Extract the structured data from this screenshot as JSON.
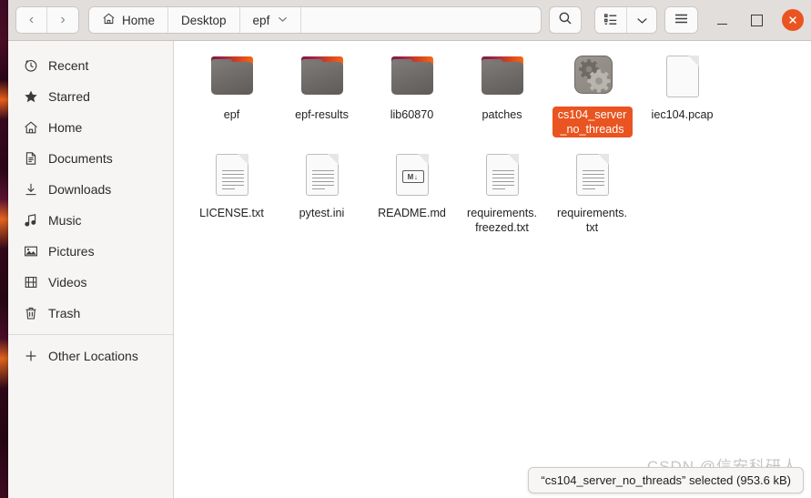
{
  "window": {
    "titlebar": {
      "nav_back": "‹",
      "nav_forward": "›",
      "breadcrumbs": [
        {
          "label": "Home",
          "icon": "home-icon",
          "has_chevron": false
        },
        {
          "label": "Desktop",
          "icon": null,
          "has_chevron": false
        },
        {
          "label": "epf",
          "icon": null,
          "has_chevron": true
        }
      ],
      "search_icon": "search-icon",
      "view_list_icon": "list-view-icon",
      "view_dropdown_icon": "chevron-down-icon",
      "menu_icon": "hamburger-menu-icon",
      "minimize_label": "Minimize",
      "maximize_label": "Maximize",
      "close_label": "Close",
      "close_color": "#e95420"
    }
  },
  "sidebar": {
    "items": [
      {
        "label": "Recent",
        "icon": "clock-icon"
      },
      {
        "label": "Starred",
        "icon": "star-icon"
      },
      {
        "label": "Home",
        "icon": "home-icon"
      },
      {
        "label": "Documents",
        "icon": "document-icon"
      },
      {
        "label": "Downloads",
        "icon": "download-icon"
      },
      {
        "label": "Music",
        "icon": "music-note-icon"
      },
      {
        "label": "Pictures",
        "icon": "picture-icon"
      },
      {
        "label": "Videos",
        "icon": "film-icon"
      },
      {
        "label": "Trash",
        "icon": "trash-icon"
      }
    ],
    "other_locations": {
      "label": "Other Locations",
      "icon": "plus-icon"
    }
  },
  "files": [
    {
      "name": "epf",
      "type": "folder",
      "selected": false
    },
    {
      "name": "epf-results",
      "type": "folder",
      "selected": false
    },
    {
      "name": "lib60870",
      "type": "folder",
      "selected": false
    },
    {
      "name": "patches",
      "type": "folder",
      "selected": false
    },
    {
      "name": "cs104_server_no_threads",
      "type": "executable",
      "selected": true
    },
    {
      "name": "iec104.pcap",
      "type": "blank-document",
      "selected": false
    },
    {
      "name": "LICENSE.txt",
      "type": "text-document",
      "selected": false
    },
    {
      "name": "pytest.ini",
      "type": "text-document",
      "selected": false
    },
    {
      "name": "README.md",
      "type": "markdown-document",
      "selected": false
    },
    {
      "name": "requirements.freezed.txt",
      "type": "text-document",
      "selected": false
    },
    {
      "name": "requirements.txt",
      "type": "text-document",
      "selected": false
    }
  ],
  "markdown_badge_text": "M↓",
  "statusbar": {
    "text": "“cs104_server_no_threads” selected (953.6 kB)"
  },
  "watermark": {
    "text": "CSDN @信安科研人"
  },
  "colors": {
    "selection": "#e95420",
    "headerbar": "#e1dedb",
    "sidebar": "#f6f5f4"
  }
}
